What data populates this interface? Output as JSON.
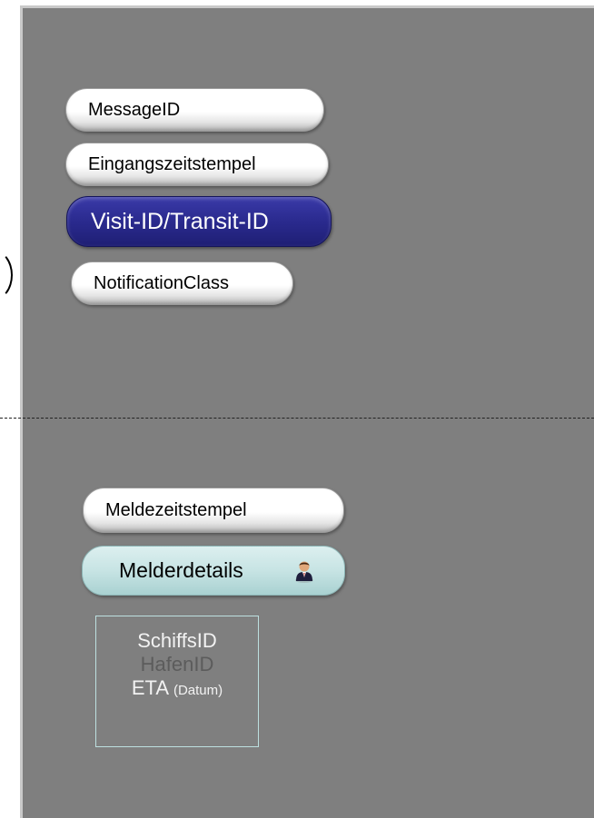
{
  "header_fields": [
    {
      "label": "MessageID"
    },
    {
      "label": "Eingangszeitstempel"
    },
    {
      "label": "Visit-ID/Transit-ID"
    },
    {
      "label": "NotificationClass"
    }
  ],
  "body_fields": {
    "meldezeitstempel": "Meldezeitstempel",
    "melderdetails": "Melderdetails"
  },
  "info_box": {
    "line1": "SchiffsID",
    "line2": "HafenID",
    "line3_main": "ETA",
    "line3_sub": "(Datum)"
  },
  "colors": {
    "panel": "#7f7f7f",
    "accent_blue": "#2a2a8e",
    "teal": "#c7e4e4"
  },
  "icons": [
    "person-icon"
  ]
}
